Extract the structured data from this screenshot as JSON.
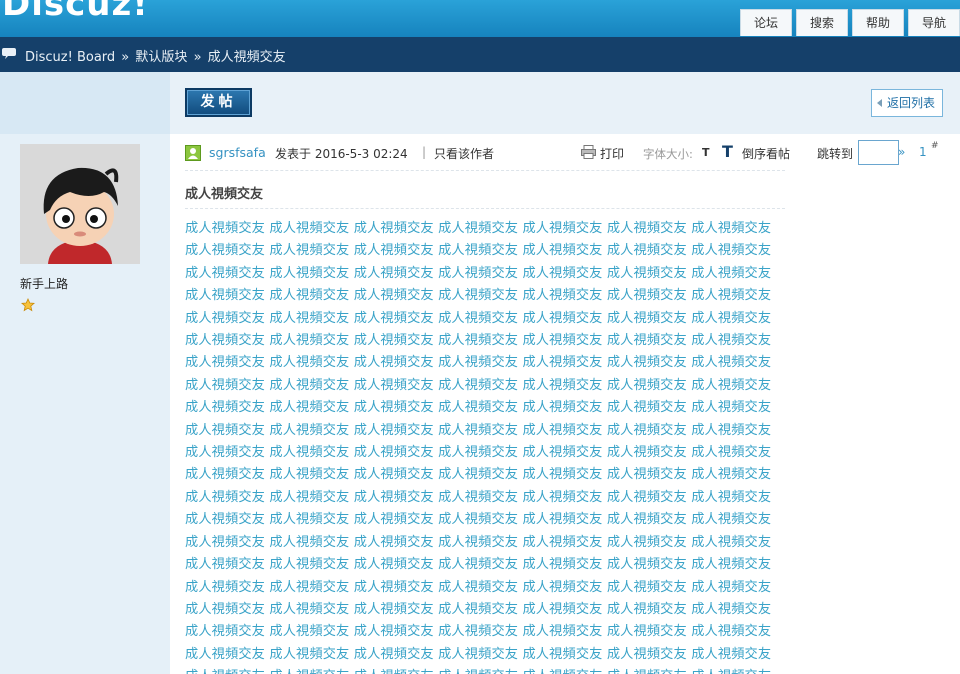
{
  "header": {
    "logo_text": "Discuz!",
    "nav_tabs": [
      {
        "label": "论坛",
        "active": true
      },
      {
        "label": "搜索",
        "active": false
      },
      {
        "label": "帮助",
        "active": false
      },
      {
        "label": "导航",
        "active": false
      }
    ]
  },
  "breadcrumb": {
    "items": [
      "Discuz! Board",
      "默认版块",
      "成人視頻交友"
    ],
    "separator": "»"
  },
  "actions": {
    "post_button": "发帖",
    "back_button": "返回列表"
  },
  "author_panel": {
    "rank": "新手上路"
  },
  "post": {
    "author": "sgrsfsafa",
    "posted_label": "发表于 2016-5-3 02:24",
    "pipe": "|",
    "only_author": "只看该作者",
    "print_label": "打印",
    "font_size_label": "字体大小:",
    "font_small": "T",
    "font_big": "T",
    "reverse_label": "倒序看帖",
    "jump_label": "跳转到",
    "jump_go": "»",
    "floor": "1",
    "floor_mark": "#",
    "title": "成人視頻交友",
    "body_phrase": "成人視頻交友",
    "body_repeat": 190
  },
  "colors": {
    "topbar": "#1a8ac7",
    "crumbbar": "#15406a",
    "link": "#3592c2",
    "body_text": "#3aa3c8"
  }
}
